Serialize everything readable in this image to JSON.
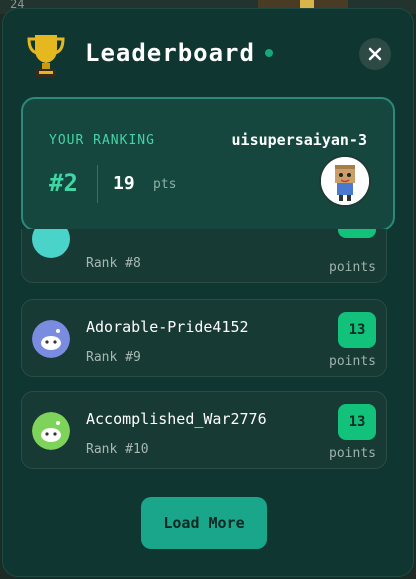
{
  "background": {
    "corner_number": "24"
  },
  "header": {
    "title": "Leaderboard",
    "close_icon": "close-icon",
    "trophy_icon": "trophy-icon",
    "live_indicator_color": "#14a97a"
  },
  "your_ranking": {
    "label": "YOUR RANKING",
    "username": "uisupersaiyan-3",
    "rank": "#2",
    "points": "19",
    "points_unit": "pts"
  },
  "entries": [
    {
      "name": "",
      "rank": "Rank #8",
      "score": "",
      "unit": "points",
      "avatar_color": "#4ad3c8"
    },
    {
      "name": "Adorable-Pride4152",
      "rank": "Rank #9",
      "score": "13",
      "unit": "points",
      "avatar_color": "#7a8ce0"
    },
    {
      "name": "Accomplished_War2776",
      "rank": "Rank #10",
      "score": "13",
      "unit": "points",
      "avatar_color": "#7ed35a"
    }
  ],
  "load_more_label": "Load More",
  "colors": {
    "accent": "#1aa68a",
    "score_badge": "#12c27a",
    "panel_bg": "#0f3630"
  }
}
